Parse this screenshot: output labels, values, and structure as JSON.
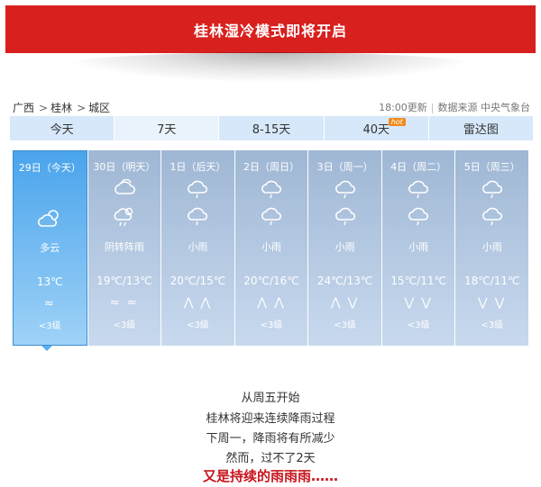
{
  "banner": {
    "title": "桂林湿冷模式即将开启"
  },
  "breadcrumb": [
    "广西",
    "桂林",
    "城区"
  ],
  "source": {
    "update_time": "18:00更新",
    "label": "数据来源 中央气象台"
  },
  "tabs": [
    {
      "label": "今天"
    },
    {
      "label": "7天",
      "active": true
    },
    {
      "label": "8-15天"
    },
    {
      "label": "40天",
      "badge": "hot"
    },
    {
      "label": "雷达图"
    }
  ],
  "days": [
    {
      "date": "29日（今天）",
      "icons": [
        "partly-cloudy-icon"
      ],
      "desc": "多云",
      "temp": "13℃",
      "wind": "≈",
      "level": "<3级"
    },
    {
      "date": "30日（明天）",
      "icons": [
        "cloudy-icon",
        "cloudy-shower-icon"
      ],
      "desc": "阴转阵雨",
      "temp": "19℃/13℃",
      "wind": "≈  ≈",
      "level": "<3级"
    },
    {
      "date": "1日（后天）",
      "icons": [
        "light-rain-icon",
        "light-rain-icon"
      ],
      "desc": "小雨",
      "temp": "20℃/15℃",
      "wind": "⋀ ⋀",
      "level": "<3级"
    },
    {
      "date": "2日（周日）",
      "icons": [
        "light-rain-icon",
        "light-rain-icon"
      ],
      "desc": "小雨",
      "temp": "20℃/16℃",
      "wind": "⋀ ⋀",
      "level": "<3级"
    },
    {
      "date": "3日（周一）",
      "icons": [
        "light-rain-icon",
        "light-rain-icon"
      ],
      "desc": "小雨",
      "temp": "24℃/13℃",
      "wind": "⋀ ⋁",
      "level": "<3级"
    },
    {
      "date": "4日（周二）",
      "icons": [
        "light-rain-icon",
        "light-rain-icon"
      ],
      "desc": "小雨",
      "temp": "15℃/11℃",
      "wind": "⋁ ⋁",
      "level": "<3级"
    },
    {
      "date": "5日（周三）",
      "icons": [
        "light-rain-icon",
        "light-rain-icon"
      ],
      "desc": "小雨",
      "temp": "18℃/11℃",
      "wind": "⋁ ⋁",
      "level": "<3级"
    }
  ],
  "message": {
    "lines": [
      "从周五开始",
      "桂林将迎来连续降雨过程",
      "下周一，降雨将有所减少",
      "然而，过不了2天"
    ],
    "emphasis": "又是持续的雨雨雨……"
  },
  "colors": {
    "banner": "#d8201e",
    "emphasis": "#c8141c",
    "today": "#4aa4ec"
  }
}
